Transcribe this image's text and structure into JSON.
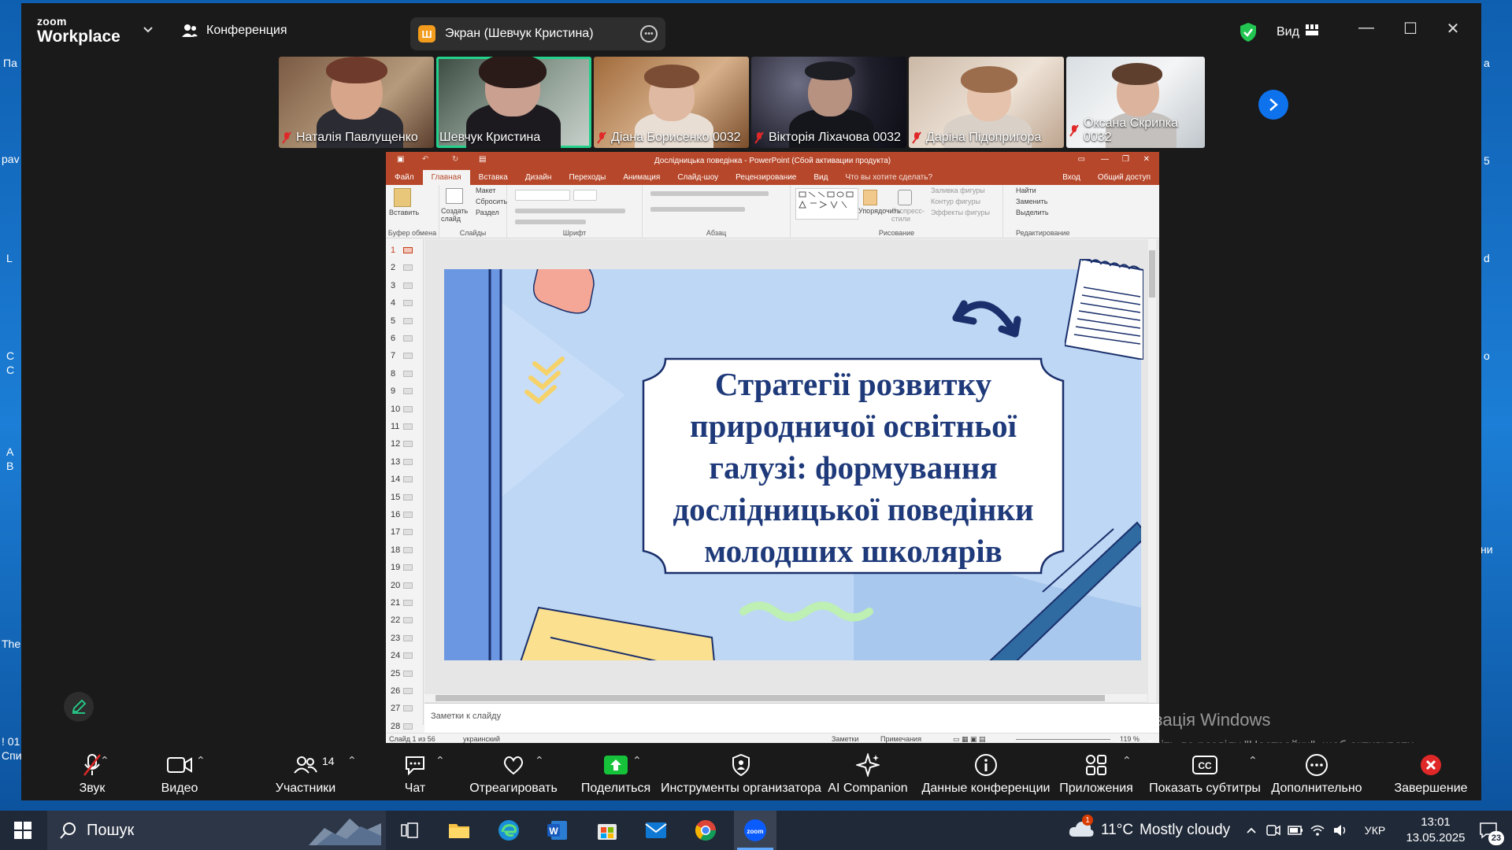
{
  "desktop": {
    "left_labels": [
      "Па",
      "pav",
      "L",
      "С",
      "С",
      "A",
      "B",
      "The",
      "! 01",
      "Спи"
    ],
    "right_labels": [
      "а",
      "5",
      "d",
      "о",
      "ни"
    ]
  },
  "zoom": {
    "logo_top": "zoom",
    "logo_bottom": "Workplace",
    "conference_label": "Конференция",
    "share_pill": {
      "badge": "Ш",
      "label": "Экран (Шевчук Кристина)"
    },
    "view_label": "Вид",
    "participants": [
      {
        "name": "Наталія Павлущенко",
        "muted": true
      },
      {
        "name": "Шевчук Кристина",
        "muted": false,
        "active": true
      },
      {
        "name": "Діана Борисенко 0032",
        "muted": true
      },
      {
        "name": "Вікторія Ліхачова 0032",
        "muted": true
      },
      {
        "name": "Даріна Підопригора",
        "muted": true
      },
      {
        "name": "Оксана Скрипка 0032",
        "muted": true
      }
    ]
  },
  "ppt": {
    "window_title": "Дослідницька поведінка - PowerPoint (Сбой активации продукта)",
    "tabs": [
      "Файл",
      "Главная",
      "Вставка",
      "Дизайн",
      "Переходы",
      "Анимация",
      "Слайд-шоу",
      "Рецензирование",
      "Вид",
      "Что вы хотите сделать?"
    ],
    "signin": "Вход",
    "share": "Общий доступ",
    "ribbon": {
      "paste": "Вставить",
      "new_slide": "Создать слайд",
      "layout": "Макет",
      "reset": "Сбросить",
      "section": "Раздел",
      "arrange": "Упорядочить",
      "quick_styles": "Экспресс-стили",
      "fill": "Заливка фигуры",
      "outline": "Контур фигуры",
      "effects": "Эффекты фигуры",
      "find": "Найти",
      "replace": "Заменить",
      "select": "Выделить",
      "groups": [
        "Буфер обмена",
        "Слайды",
        "Шрифт",
        "Абзац",
        "Рисование",
        "Редактирование"
      ]
    },
    "slide_numbers": [
      "1",
      "2",
      "3",
      "4",
      "5",
      "6",
      "7",
      "8",
      "9",
      "10",
      "11",
      "12",
      "13",
      "14",
      "15",
      "16",
      "17",
      "18",
      "19",
      "20",
      "21",
      "22",
      "23",
      "24",
      "25",
      "26",
      "27",
      "28"
    ],
    "slide_title_lines": [
      "Стратегії розвитку",
      "природничої освітньої",
      "галузі: формування",
      "дослідницької поведінки",
      "молодших школярів"
    ],
    "notes_placeholder": "Заметки к слайду",
    "status": {
      "slide_of": "Слайд 1 из 56",
      "language": "украинский",
      "notes": "Заметки",
      "comments": "Примечания",
      "zoom": "119 %"
    }
  },
  "watermark": {
    "line1": "Активація Windows",
    "line2": "Перейдіть до розділу \"Настройки\", щоб активувати Windows."
  },
  "toolbar": {
    "audio": "Звук",
    "video": "Видео",
    "participants": "Участники",
    "participants_count": "14",
    "chat": "Чат",
    "react": "Отреагировать",
    "share": "Поделиться",
    "host_tools": "Инструменты организатора",
    "ai": "AI Companion",
    "meeting_info": "Данные конференции",
    "apps": "Приложения",
    "captions": "Показать субтитры",
    "more": "Дополнительно",
    "end": "Завершение"
  },
  "taskbar": {
    "search": "Пошук",
    "weather_temp": "11°C",
    "weather_text": "Mostly cloudy",
    "weather_badge": "1",
    "lang": "УКР",
    "time": "13:01",
    "date": "13.05.2025",
    "notif_count": "23"
  }
}
